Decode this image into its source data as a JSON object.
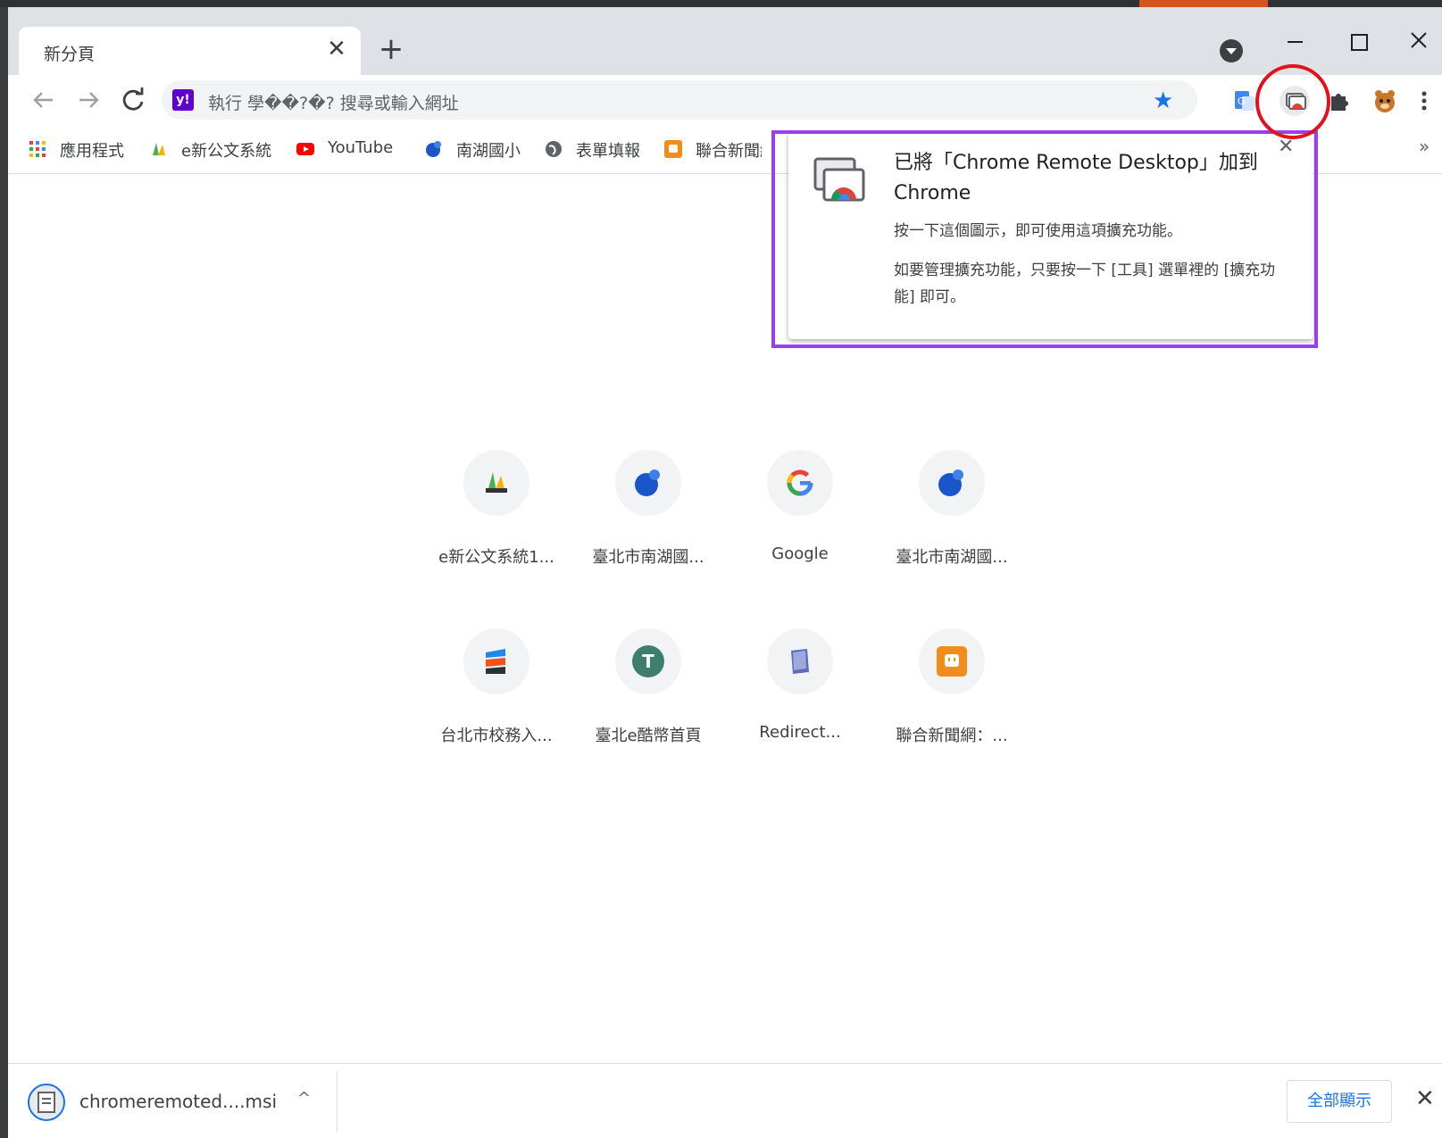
{
  "tab": {
    "title": "新分頁",
    "close": "✕"
  },
  "new_tab": "+",
  "omnibox": {
    "text": "執行 學��?�? 搜尋或輸入網址"
  },
  "bookmarks": [
    {
      "label": "應用程式",
      "icon": "apps-grid-icon"
    },
    {
      "label": "e新公文系統",
      "icon": "taipei-logo-icon"
    },
    {
      "label": "YouTube",
      "icon": "youtube-icon"
    },
    {
      "label": "南湖國小",
      "icon": "globe-ball-icon"
    },
    {
      "label": "表單填報",
      "icon": "globe-icon"
    },
    {
      "label": "聯合新聞網",
      "icon": "udn-icon"
    }
  ],
  "bookmarks_more": "»",
  "popup": {
    "title": "已將「Chrome Remote Desktop」加到 Chrome",
    "line1": "按一下這個圖示，即可使用這項擴充功能。",
    "line2": "如要管理擴充功能，只要按一下 [工具] 選單裡的 [擴充功能] 即可。",
    "close": "✕"
  },
  "shortcuts": [
    {
      "label": "e新公文系統1...",
      "icon": "taipei-logo-icon"
    },
    {
      "label": "臺北市南湖國...",
      "icon": "globe-ball-icon"
    },
    {
      "label": "Google",
      "icon": "google-icon"
    },
    {
      "label": "臺北市南湖國...",
      "icon": "globe-ball-icon"
    },
    {
      "label": "台北市校務入...",
      "icon": "stack-logo-icon"
    },
    {
      "label": "臺北e酷幣首頁",
      "icon": "letter-t-icon",
      "letter": "T"
    },
    {
      "label": "Redirect...",
      "icon": "book-icon"
    },
    {
      "label": "聯合新聞網：...",
      "icon": "udn-icon"
    }
  ],
  "download": {
    "filename": "chromeremoted....msi",
    "chevron": "^",
    "show_all": "全部顯示",
    "close": "✕"
  },
  "colors": {
    "accent": "#1a73e8",
    "highlight_outline": "#9b3ef0",
    "highlight_circle": "#e4101b"
  }
}
